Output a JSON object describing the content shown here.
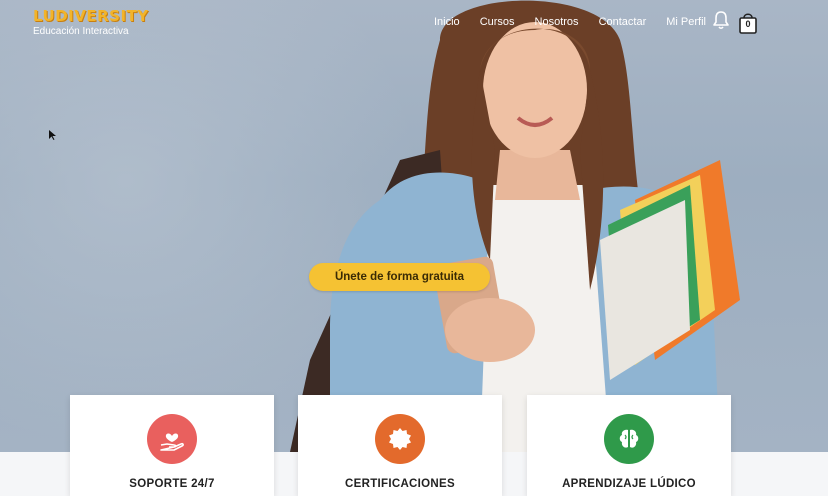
{
  "brand": {
    "name": "LUDIVERSITY",
    "tagline": "Educación Interactiva"
  },
  "nav": {
    "items": [
      "Inicio",
      "Cursos",
      "Nosotros",
      "Contactar",
      "Mi Perfil"
    ]
  },
  "cart": {
    "count": "0"
  },
  "hero": {
    "cta_label": "Únete de forma gratuita"
  },
  "features": [
    {
      "title": "SOPORTE 24/7",
      "icon": "heart-hand-icon",
      "color": "#e9605e"
    },
    {
      "title": "CERTIFICACIONES",
      "icon": "badge-icon",
      "color": "#e36a2c"
    },
    {
      "title": "APRENDIZAJE LÚDICO",
      "icon": "brain-icon",
      "color": "#2f9a4a"
    }
  ],
  "colors": {
    "brand_yellow": "#f2b42a",
    "cta_yellow": "#f5c233"
  }
}
